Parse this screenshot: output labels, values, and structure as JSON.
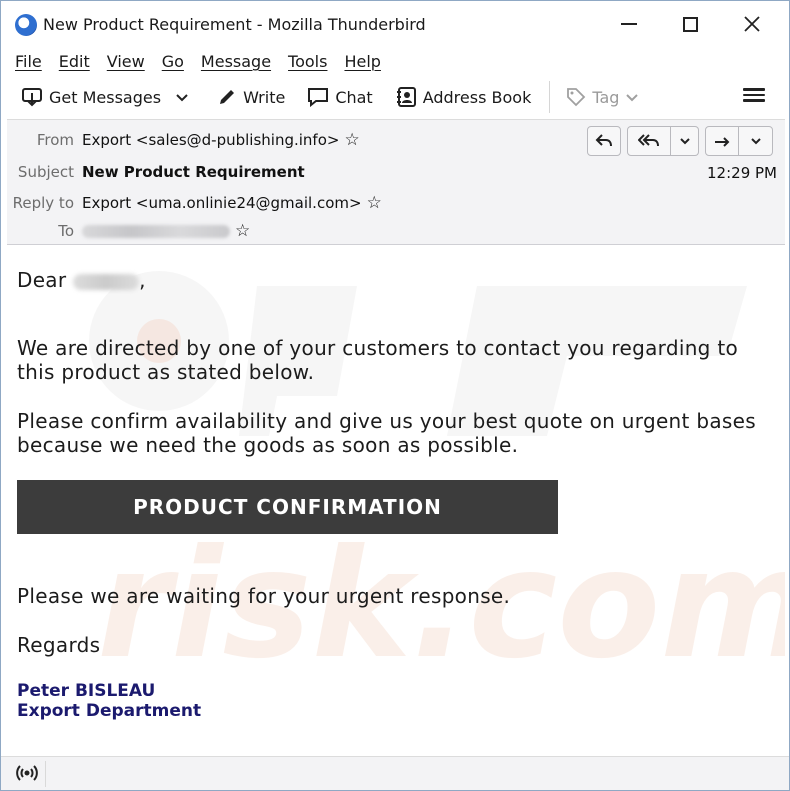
{
  "window": {
    "title": "New Product Requirement - Mozilla Thunderbird"
  },
  "menu": {
    "items": [
      "File",
      "Edit",
      "View",
      "Go",
      "Message",
      "Tools",
      "Help"
    ]
  },
  "toolbar": {
    "get_messages": "Get Messages",
    "write": "Write",
    "chat": "Chat",
    "address_book": "Address Book",
    "tag": "Tag"
  },
  "header": {
    "from_label": "From",
    "from_value": "Export <sales@d-publishing.info>",
    "subject_label": "Subject",
    "subject_value": "New Product Requirement",
    "reply_to_label": "Reply to",
    "reply_to_value": "Export <uma.onlinie24@gmail.com>",
    "to_label": "To",
    "time": "12:29 PM"
  },
  "body": {
    "greeting": "Dear",
    "greeting_suffix": ",",
    "para1": "We are directed by one of your customers to contact you regarding to this product as stated below.",
    "para2": "Please confirm availability and give us your best quote on urgent bases because we need the goods as soon as possible.",
    "button_label": "PRODUCT CONFIRMATION",
    "para3": "Please we are waiting for your urgent response.",
    "regards": "Regards",
    "signature_name": "Peter BISLEAU",
    "signature_dept": "Export Department"
  },
  "colors": {
    "signature": "#1b1a6e",
    "button_bg": "#3c3c3c",
    "header_bg": "#f3f3f5"
  }
}
